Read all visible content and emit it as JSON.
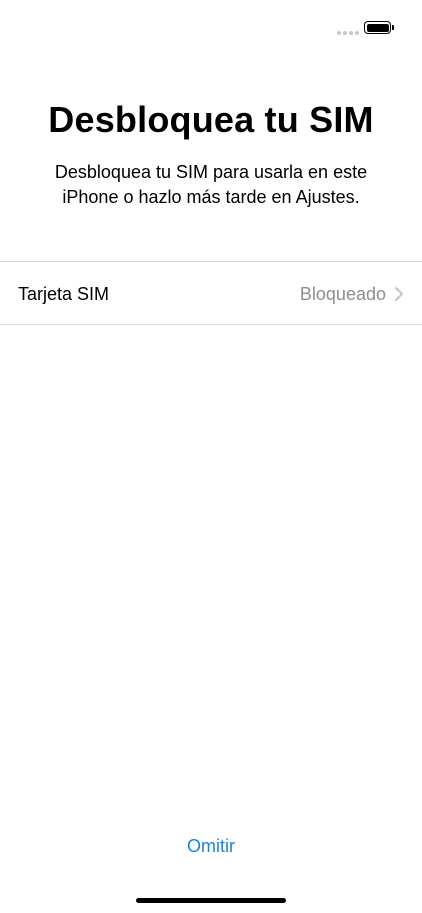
{
  "status_bar": {
    "signal_icon": "signal-dots-icon",
    "battery_icon": "battery-full-icon",
    "battery_level": 1.0
  },
  "header": {
    "title": "Desbloquea tu SIM",
    "subtitle": "Desbloquea tu SIM para usarla en este iPhone o hazlo más tarde en Ajustes."
  },
  "sim_row": {
    "label": "Tarjeta SIM",
    "value": "Bloqueado",
    "chevron_icon": "chevron-right-icon"
  },
  "footer": {
    "skip_label": "Omitir"
  },
  "colors": {
    "accent": "#1a85d6",
    "secondary_text": "#8e8e93",
    "separator": "#d8d8dc"
  }
}
